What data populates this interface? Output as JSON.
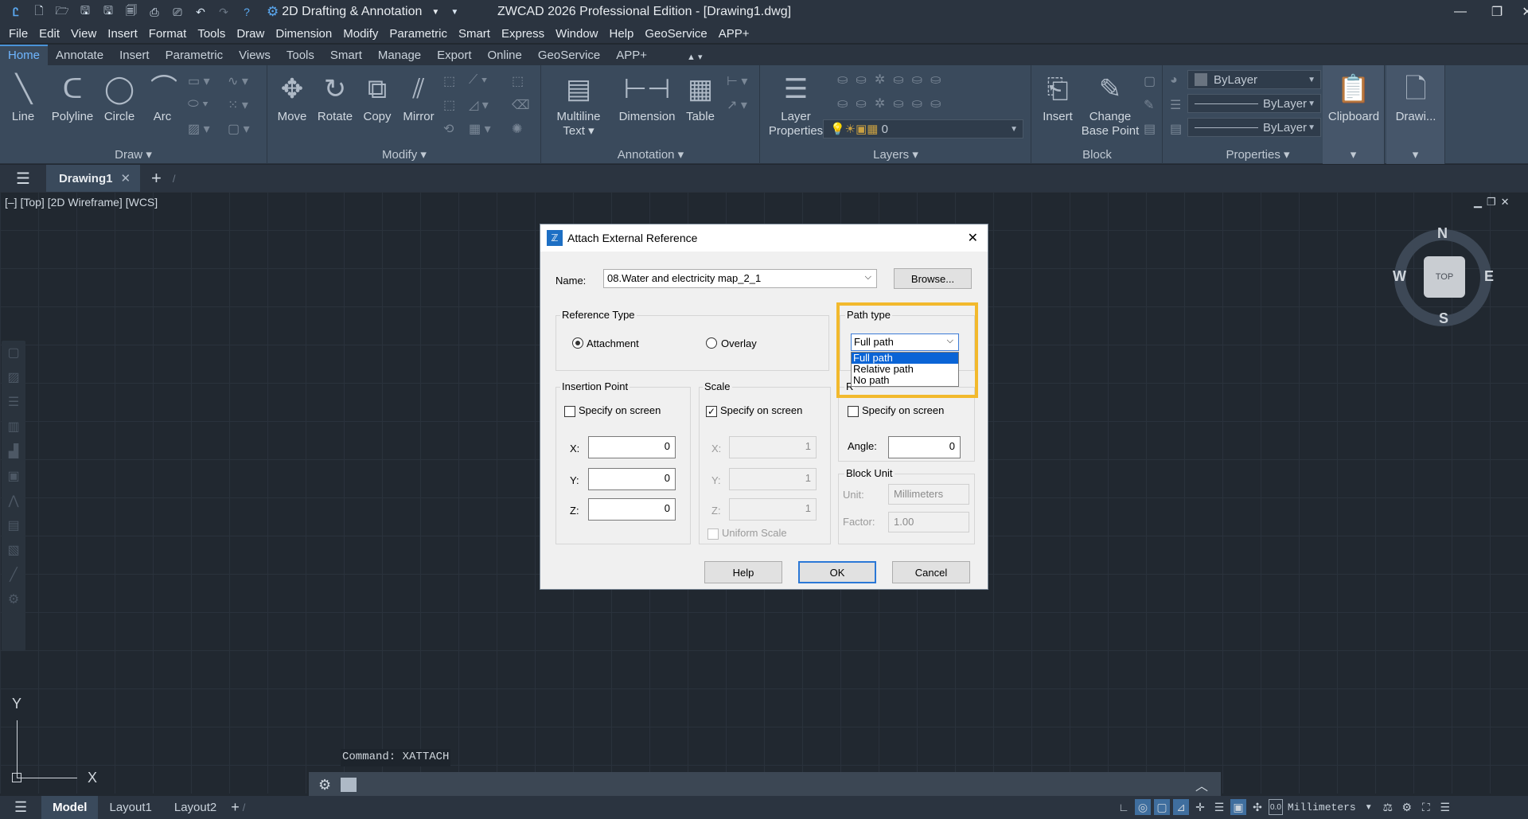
{
  "app": {
    "window_title": "ZWCAD 2026 Professional Edition - [Drawing1.dwg]",
    "workspace": "2D Drafting & Annotation"
  },
  "menubar": [
    "File",
    "Edit",
    "View",
    "Insert",
    "Format",
    "Tools",
    "Draw",
    "Dimension",
    "Modify",
    "Parametric",
    "Smart",
    "Express",
    "Window",
    "Help",
    "GeoService",
    "APP+"
  ],
  "ribbon_tabs": [
    "Home",
    "Annotate",
    "Insert",
    "Parametric",
    "Views",
    "Tools",
    "Smart",
    "Manage",
    "Export",
    "Online",
    "GeoService",
    "APP+"
  ],
  "ribbon": {
    "draw": {
      "title": "Draw",
      "line": "Line",
      "polyline": "Polyline",
      "circle": "Circle",
      "arc": "Arc"
    },
    "modify": {
      "title": "Modify",
      "move": "Move",
      "rotate": "Rotate",
      "copy": "Copy",
      "mirror": "Mirror"
    },
    "annotation": {
      "title": "Annotation",
      "mtext_1": "Multiline",
      "mtext_2": "Text",
      "dimension": "Dimension",
      "table": "Table"
    },
    "layers": {
      "title": "Layers",
      "layer_props_1": "Layer",
      "layer_props_2": "Properties",
      "layer_value": "0"
    },
    "block": {
      "title": "Block",
      "insert": "Insert",
      "change_base_1": "Change",
      "change_base_2": "Base Point"
    },
    "properties": {
      "title": "Properties",
      "color": "ByLayer",
      "linetype": "ByLayer",
      "lineweight": "ByLayer"
    },
    "clipboard": {
      "title": "Clipboard"
    },
    "drawing": {
      "title": "Drawi..."
    }
  },
  "doc_tabs": {
    "active": "Drawing1"
  },
  "viewport_label": "[–] [Top] [2D Wireframe] [WCS]",
  "viewcube": {
    "top": "TOP",
    "n": "N",
    "s": "S",
    "e": "E",
    "w": "W"
  },
  "ucs": {
    "x": "X",
    "y": "Y"
  },
  "command_line": "Command: XATTACH",
  "layout_tabs": [
    "Model",
    "Layout1",
    "Layout2"
  ],
  "status_units": "Millimeters",
  "dialog": {
    "title": "Attach External Reference",
    "name_label": "Name:",
    "name_value": "08.Water and electricity map_2_1",
    "browse": "Browse...",
    "reference_type": {
      "label": "Reference Type",
      "attachment": "Attachment",
      "overlay": "Overlay",
      "selected": "Attachment"
    },
    "path_type": {
      "label": "Path type",
      "selected": "Full path",
      "options": [
        "Full path",
        "Relative path",
        "No path"
      ]
    },
    "insertion_point": {
      "label": "Insertion Point",
      "specify": "Specify on screen",
      "specify_checked": false,
      "x_label": "X:",
      "y_label": "Y:",
      "z_label": "Z:",
      "x": "0",
      "y": "0",
      "z": "0"
    },
    "scale": {
      "label": "Scale",
      "specify": "Specify on screen",
      "specify_checked": true,
      "x_label": "X:",
      "y_label": "Y:",
      "z_label": "Z:",
      "x": "1",
      "y": "1",
      "z": "1",
      "uniform": "Uniform Scale"
    },
    "rotation": {
      "label_partial": "R",
      "specify": "Specify on screen",
      "specify_checked": false,
      "angle_label": "Angle:",
      "angle": "0"
    },
    "block_unit": {
      "label": "Block Unit",
      "unit_label": "Unit:",
      "unit": "Millimeters",
      "factor_label": "Factor:",
      "factor": "1.00"
    },
    "help": "Help",
    "ok": "OK",
    "cancel": "Cancel",
    "close_glyph": "✕"
  }
}
